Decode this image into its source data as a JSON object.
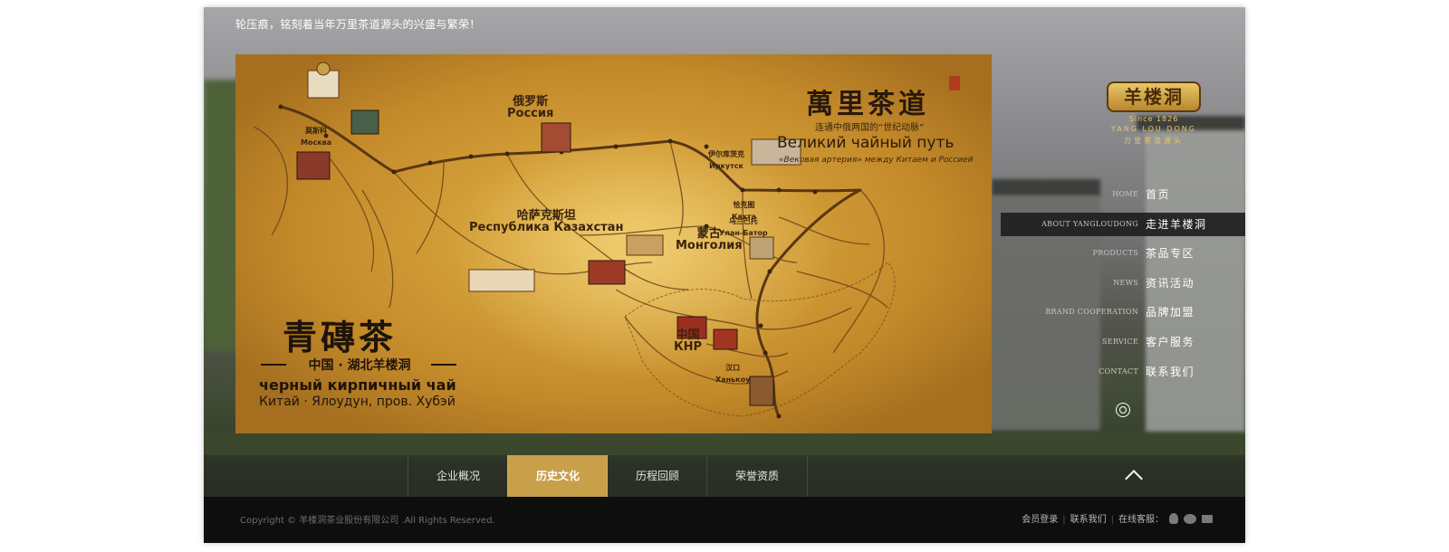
{
  "banner": {
    "slogan": "轮压痕，铭刻着当年万里茶道源头的兴盛与繁荣！"
  },
  "map": {
    "title": "萬里茶道",
    "subtitle": "连通中俄两国的“世纪动脉”",
    "ru_title": "Великий чайный путь",
    "ru_subtitle": "«Вековая артерия» между Китаем и Россией",
    "brick_tea_cn": "青磚茶",
    "brick_origin": "中国 · 湖北羊楼洞",
    "brick_tea_ru": "черный кирпичный чай",
    "brick_location_ru": "Китай · Ялоудун, пров. Хубэй",
    "region_labels": [
      {
        "cn": "俄罗斯",
        "ru": "Россия"
      },
      {
        "cn": "哈萨克斯坦",
        "ru": "Республика Казахстан"
      },
      {
        "cn": "蒙古",
        "ru": "Монголия"
      },
      {
        "cn": "中国",
        "ru": "КНР"
      },
      {
        "cn": "莫斯科",
        "ru": "Москва"
      },
      {
        "cn": "伊尔库茨克",
        "ru": "Иркутск"
      },
      {
        "cn": "恰克图",
        "ru": "Кяхта"
      },
      {
        "cn": "乌兰巴托",
        "ru": "Улан-Батор"
      },
      {
        "cn": "汉口",
        "ru": "Ханькоу"
      }
    ]
  },
  "logo": {
    "name": "羊楼洞",
    "since": "Since 1826",
    "en": "YANG LOU DONG",
    "sub": "万里茶道源头"
  },
  "nav": [
    {
      "en": "HOME",
      "cn": "首页",
      "active": false
    },
    {
      "en": "ABOUT YANGLOUDONG",
      "cn": "走进羊楼洞",
      "active": true
    },
    {
      "en": "PRODUCTS",
      "cn": "茶品专区",
      "active": false
    },
    {
      "en": "NEWS",
      "cn": "资讯活动",
      "active": false
    },
    {
      "en": "BRAND COOPERATION",
      "cn": "品牌加盟",
      "active": false
    },
    {
      "en": "SERVICE",
      "cn": "客户服务",
      "active": false
    },
    {
      "en": "CONTACT",
      "cn": "联系我们",
      "active": false
    }
  ],
  "subnav": [
    {
      "label": "企业概况",
      "active": false
    },
    {
      "label": "历史文化",
      "active": true
    },
    {
      "label": "历程回顾",
      "active": false
    },
    {
      "label": "荣誉资质",
      "active": false
    }
  ],
  "footer": {
    "copyright": "Copyright © 羊楼洞茶业股份有限公司 .All Rights Reserved.",
    "member_login": "会员登录",
    "contact_us": "联系我们",
    "online_service": "在线客服："
  },
  "colors": {
    "accent": "#c9a04a",
    "footer_bg": "#0e0e0e",
    "nav_active_bg": "#1e1e1e"
  }
}
